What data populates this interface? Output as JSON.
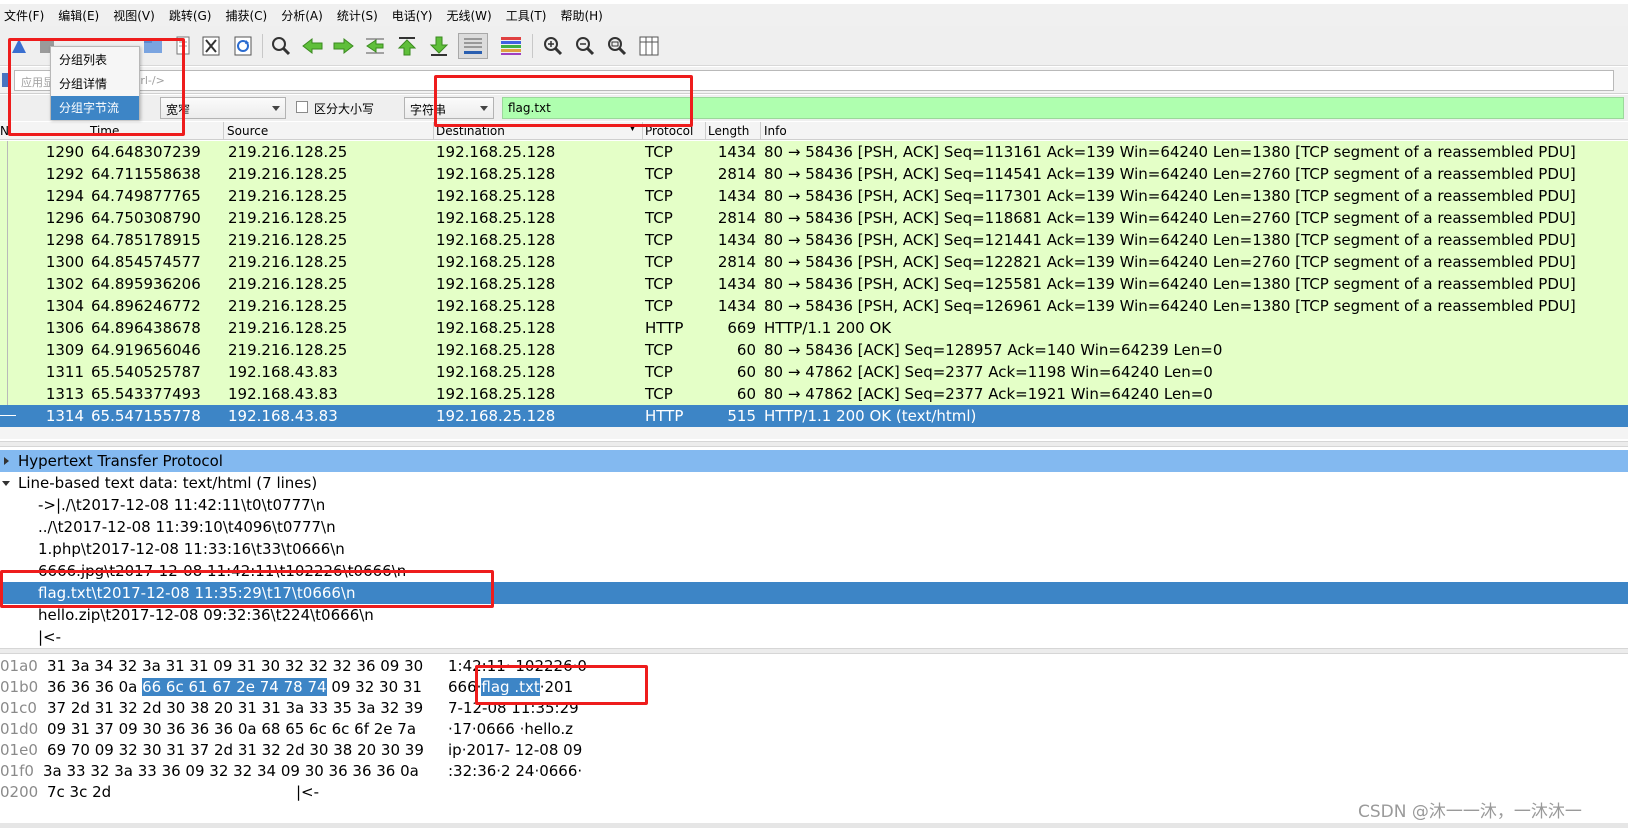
{
  "menubar": {
    "items": [
      "文件(F)",
      "编辑(E)",
      "视图(V)",
      "跳转(G)",
      "捕获(C)",
      "分析(A)",
      "统计(S)",
      "电话(Y)",
      "无线(W)",
      "工具(T)",
      "帮助(H)"
    ]
  },
  "filter": {
    "placeholder_left": "应用显",
    "placeholder_right": "trl-/>"
  },
  "findbar": {
    "encoding": "宽窄",
    "case_label": "区分大小写",
    "type": "字符串",
    "search_value": "flag.txt"
  },
  "popup": {
    "items": [
      "分组列表",
      "分组详情",
      "分组字节流"
    ]
  },
  "columns": {
    "no": "N",
    "time": "Time",
    "source": "Source",
    "destination": "Destination",
    "protocol": "Protocol",
    "length": "Length",
    "info": "Info"
  },
  "packets": [
    {
      "no": "1290",
      "time": "64.648307239",
      "src": "219.216.128.25",
      "dst": "192.168.25.128",
      "proto": "TCP",
      "len": "1434",
      "info": "80 → 58436 [PSH, ACK] Seq=113161 Ack=139 Win=64240 Len=1380 [TCP segment of a reassembled PDU]"
    },
    {
      "no": "1292",
      "time": "64.711558638",
      "src": "219.216.128.25",
      "dst": "192.168.25.128",
      "proto": "TCP",
      "len": "2814",
      "info": "80 → 58436 [PSH, ACK] Seq=114541 Ack=139 Win=64240 Len=2760 [TCP segment of a reassembled PDU]"
    },
    {
      "no": "1294",
      "time": "64.749877765",
      "src": "219.216.128.25",
      "dst": "192.168.25.128",
      "proto": "TCP",
      "len": "1434",
      "info": "80 → 58436 [PSH, ACK] Seq=117301 Ack=139 Win=64240 Len=1380 [TCP segment of a reassembled PDU]"
    },
    {
      "no": "1296",
      "time": "64.750308790",
      "src": "219.216.128.25",
      "dst": "192.168.25.128",
      "proto": "TCP",
      "len": "2814",
      "info": "80 → 58436 [PSH, ACK] Seq=118681 Ack=139 Win=64240 Len=2760 [TCP segment of a reassembled PDU]"
    },
    {
      "no": "1298",
      "time": "64.785178915",
      "src": "219.216.128.25",
      "dst": "192.168.25.128",
      "proto": "TCP",
      "len": "1434",
      "info": "80 → 58436 [PSH, ACK] Seq=121441 Ack=139 Win=64240 Len=1380 [TCP segment of a reassembled PDU]"
    },
    {
      "no": "1300",
      "time": "64.854574577",
      "src": "219.216.128.25",
      "dst": "192.168.25.128",
      "proto": "TCP",
      "len": "2814",
      "info": "80 → 58436 [PSH, ACK] Seq=122821 Ack=139 Win=64240 Len=2760 [TCP segment of a reassembled PDU]"
    },
    {
      "no": "1302",
      "time": "64.895936206",
      "src": "219.216.128.25",
      "dst": "192.168.25.128",
      "proto": "TCP",
      "len": "1434",
      "info": "80 → 58436 [PSH, ACK] Seq=125581 Ack=139 Win=64240 Len=1380 [TCP segment of a reassembled PDU]"
    },
    {
      "no": "1304",
      "time": "64.896246772",
      "src": "219.216.128.25",
      "dst": "192.168.25.128",
      "proto": "TCP",
      "len": "1434",
      "info": "80 → 58436 [PSH, ACK] Seq=126961 Ack=139 Win=64240 Len=1380 [TCP segment of a reassembled PDU]"
    },
    {
      "no": "1306",
      "time": "64.896438678",
      "src": "219.216.128.25",
      "dst": "192.168.25.128",
      "proto": "HTTP",
      "len": "669",
      "info": "HTTP/1.1 200 OK"
    },
    {
      "no": "1309",
      "time": "64.919656046",
      "src": "219.216.128.25",
      "dst": "192.168.25.128",
      "proto": "TCP",
      "len": "60",
      "info": "80 → 58436 [ACK] Seq=128957 Ack=140 Win=64239 Len=0"
    },
    {
      "no": "1311",
      "time": "65.540525787",
      "src": "192.168.43.83",
      "dst": "192.168.25.128",
      "proto": "TCP",
      "len": "60",
      "info": "80 → 47862 [ACK] Seq=2377 Ack=1198 Win=64240 Len=0"
    },
    {
      "no": "1313",
      "time": "65.543377493",
      "src": "192.168.43.83",
      "dst": "192.168.25.128",
      "proto": "TCP",
      "len": "60",
      "info": "80 → 47862 [ACK] Seq=2377 Ack=1921 Win=64240 Len=0"
    },
    {
      "no": "1314",
      "time": "65.547155778",
      "src": "192.168.43.83",
      "dst": "192.168.25.128",
      "proto": "HTTP",
      "len": "515",
      "info": "HTTP/1.1 200 OK  (text/html)"
    }
  ],
  "details": {
    "http": "Hypertext Transfer Protocol",
    "linebased": "Line-based text data: text/html (7 lines)",
    "lines": [
      "->|./\\t2017-12-08 11:42:11\\t0\\t0777\\n",
      "../\\t2017-12-08 11:39:10\\t4096\\t0777\\n",
      "1.php\\t2017-12-08 11:33:16\\t33\\t0666\\n",
      "6666.jpg\\t2017-12-08 11:42:11\\t102226\\t0666\\n",
      "flag.txt\\t2017-12-08 11:35:29\\t17\\t0666\\n",
      "hello.zip\\t2017-12-08 09:32:36\\t224\\t0666\\n",
      "|<-"
    ]
  },
  "bytes": [
    {
      "off": "01a0",
      "hex_a": "31 3a 34 32 3a 31 31 09  31 30 32 32 32 36 09 30",
      "hex_sel": "",
      "hex_b": "",
      "asc_a": "1:42:11· 102226·0",
      "asc_sel": "",
      "asc_b": ""
    },
    {
      "off": "01b0",
      "hex_a": "36 36 36 0a ",
      "hex_sel": "66 6c 61 67  2e 74 78 74",
      "hex_b": " 09 32 30 31",
      "asc_a": "666·",
      "asc_sel": "flag .txt",
      "asc_b": "·201"
    },
    {
      "off": "01c0",
      "hex_a": "37 2d 31 32 2d 30 38 20  31 31 3a 33 35 3a 32 39",
      "hex_sel": "",
      "hex_b": "",
      "asc_a": "7-12-08  11:35:29",
      "asc_sel": "",
      "asc_b": ""
    },
    {
      "off": "01d0",
      "hex_a": "09 31 37 09 30 36 36 36  0a 68 65 6c 6c 6f 2e 7a",
      "hex_sel": "",
      "hex_b": "",
      "asc_a": "·17·0666 ·hello.z",
      "asc_sel": "",
      "asc_b": ""
    },
    {
      "off": "01e0",
      "hex_a": "69 70 09 32 30 31 37 2d  31 32 2d 30 38 20 30 39",
      "hex_sel": "",
      "hex_b": "",
      "asc_a": "ip·2017- 12-08 09",
      "asc_sel": "",
      "asc_b": ""
    },
    {
      "off": "01f0",
      "hex_a": "3a 33 32 3a 33 36 09 32  32 34 09 30 36 36 36 0a",
      "hex_sel": "",
      "hex_b": "",
      "asc_a": ":32:36·2 24·0666·",
      "asc_sel": "",
      "asc_b": ""
    },
    {
      "off": "0200",
      "hex_a": "7c 3c 2d",
      "hex_sel": "",
      "hex_b": "",
      "asc_a": "|<-",
      "asc_sel": "",
      "asc_b": ""
    }
  ],
  "watermark": "CSDN @沐一一沐，一沐沐一",
  "colors": {
    "selection": "#3d85c6",
    "packet_bg": "#e4ffc7",
    "search_bg": "#afffaf",
    "annotation": "#ee1c1c"
  }
}
